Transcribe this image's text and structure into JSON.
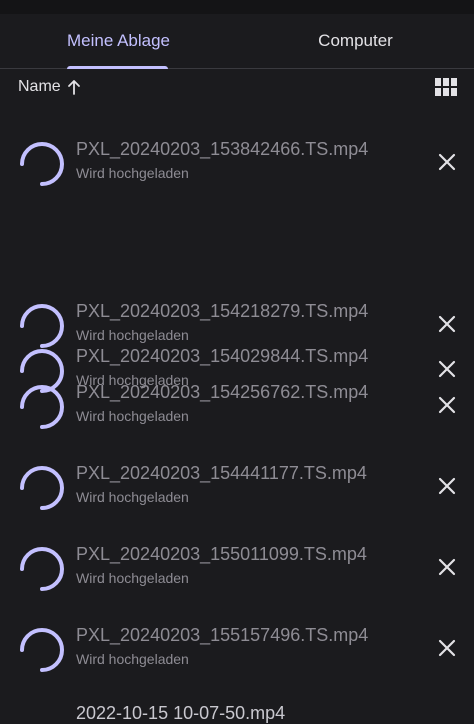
{
  "tabs": [
    {
      "label": "Meine Ablage",
      "active": true
    },
    {
      "label": "Computer",
      "active": false
    }
  ],
  "sort": {
    "label": "Name",
    "icon": "arrow-up-icon"
  },
  "view_toggle_icon": "grid-view-icon",
  "accent_color": "#c3c0ff",
  "files": [
    {
      "name": "PXL_20240203_153842466.TS.mp4",
      "status": "Wird hochgeladen"
    },
    {
      "name": "PXL_20240203_154218279.TS.mp4",
      "status": "Wird hochgeladen"
    },
    {
      "name": "PXL_20240203_154029844.TS.mp4",
      "status": "Wird hochgeladen"
    },
    {
      "name": "PXL_20240203_154256762.TS.mp4",
      "status": "Wird hochgeladen"
    },
    {
      "name": "PXL_20240203_154441177.TS.mp4",
      "status": "Wird hochgeladen"
    },
    {
      "name": "PXL_20240203_155011099.TS.mp4",
      "status": "Wird hochgeladen"
    },
    {
      "name": "PXL_20240203_155157496.TS.mp4",
      "status": "Wird hochgeladen"
    }
  ],
  "partial_file": {
    "name": "2022-10-15 10-07-50.mp4"
  }
}
